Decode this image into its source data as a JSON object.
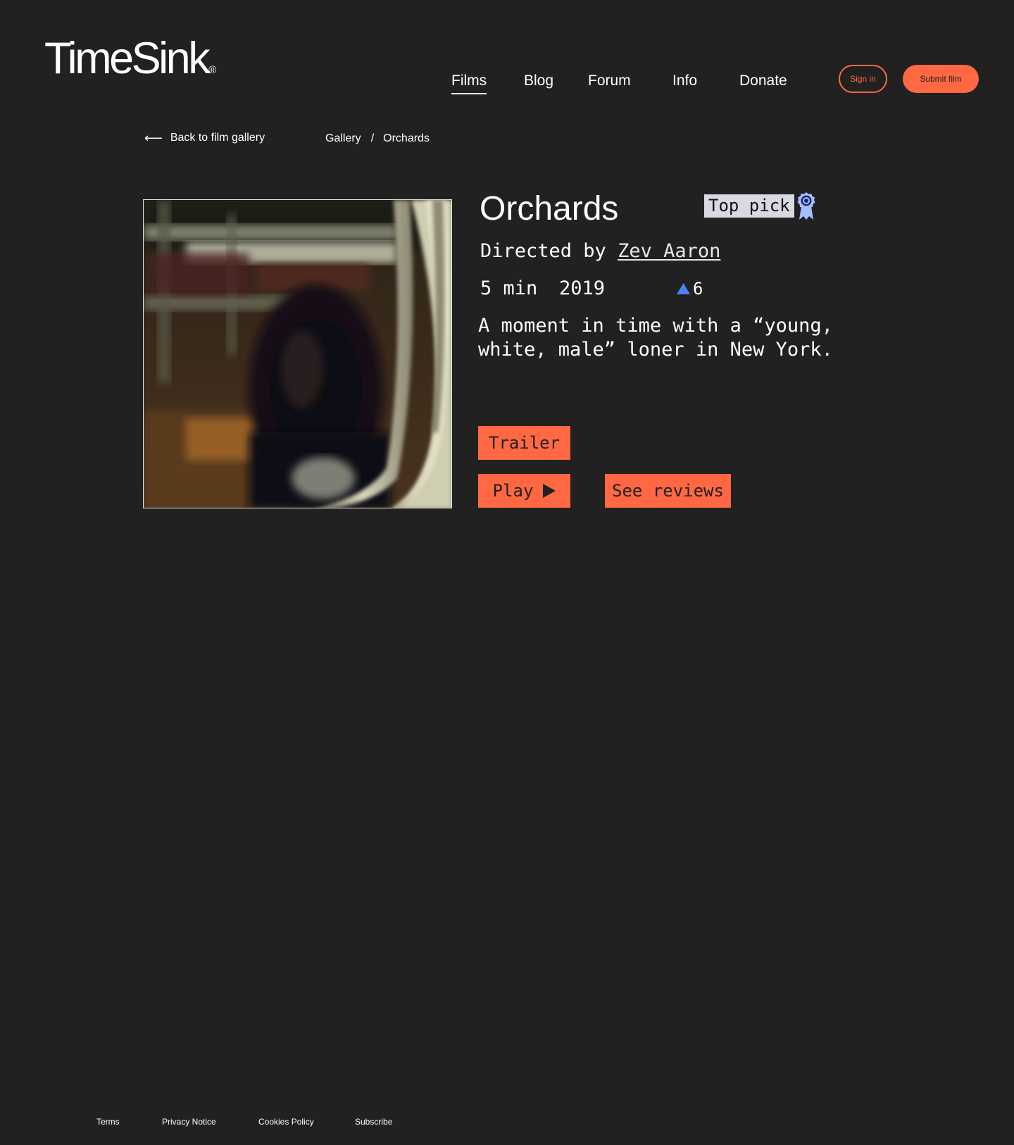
{
  "header": {
    "logo_text": "TimeSink",
    "logo_mark": "®",
    "nav": [
      {
        "label": "Films",
        "active": true
      },
      {
        "label": "Blog",
        "active": false
      },
      {
        "label": "Forum",
        "active": false
      },
      {
        "label": "Info",
        "active": false
      },
      {
        "label": "Donate",
        "active": false
      }
    ],
    "sign_in_label": "Sign in",
    "submit_label": "Submit film"
  },
  "subheader": {
    "back_arrow": "⟵",
    "back_label": "Back to film gallery",
    "breadcrumb": {
      "items": [
        "Gallery",
        "Orchards"
      ],
      "separator": "/"
    }
  },
  "film": {
    "title": "Orchards",
    "badge": "Top pick",
    "badge_icon": "award-ribbon-icon",
    "director_prefix": "Directed by",
    "director_name": "Zev Aaron",
    "duration": "5 min",
    "year": "2019",
    "votes": "6",
    "vote_icon": "upvote-triangle-icon",
    "description": "A moment in time with a “young, white, male” loner in New York.",
    "poster_icon": "film-still-image"
  },
  "actions": {
    "trailer_label": "Trailer",
    "play_label": "Play",
    "play_icon": "play-icon",
    "reviews_label": "See reviews"
  },
  "footer": {
    "links": [
      "Terms",
      "Privacy Notice",
      "Cookies Policy",
      "Subscribe"
    ]
  },
  "colors": {
    "background": "#212121",
    "accent": "#ff6842",
    "badge_bg": "#d9d9e3",
    "vote_blue": "#4d7fff",
    "award_blue": "#a6bdff"
  }
}
